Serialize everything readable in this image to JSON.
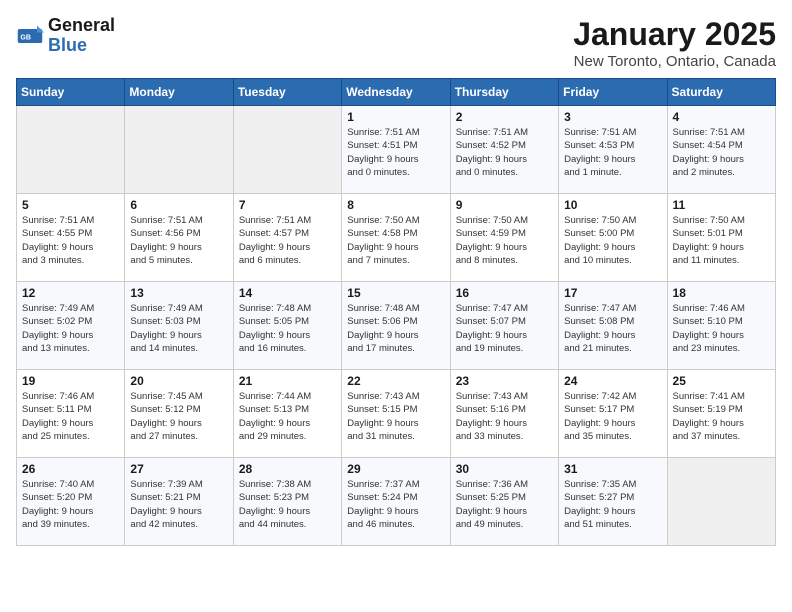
{
  "logo": {
    "line1": "General",
    "line2": "Blue"
  },
  "title": "January 2025",
  "subtitle": "New Toronto, Ontario, Canada",
  "days_header": [
    "Sunday",
    "Monday",
    "Tuesday",
    "Wednesday",
    "Thursday",
    "Friday",
    "Saturday"
  ],
  "weeks": [
    [
      {
        "num": "",
        "detail": ""
      },
      {
        "num": "",
        "detail": ""
      },
      {
        "num": "",
        "detail": ""
      },
      {
        "num": "1",
        "detail": "Sunrise: 7:51 AM\nSunset: 4:51 PM\nDaylight: 9 hours\nand 0 minutes."
      },
      {
        "num": "2",
        "detail": "Sunrise: 7:51 AM\nSunset: 4:52 PM\nDaylight: 9 hours\nand 0 minutes."
      },
      {
        "num": "3",
        "detail": "Sunrise: 7:51 AM\nSunset: 4:53 PM\nDaylight: 9 hours\nand 1 minute."
      },
      {
        "num": "4",
        "detail": "Sunrise: 7:51 AM\nSunset: 4:54 PM\nDaylight: 9 hours\nand 2 minutes."
      }
    ],
    [
      {
        "num": "5",
        "detail": "Sunrise: 7:51 AM\nSunset: 4:55 PM\nDaylight: 9 hours\nand 3 minutes."
      },
      {
        "num": "6",
        "detail": "Sunrise: 7:51 AM\nSunset: 4:56 PM\nDaylight: 9 hours\nand 5 minutes."
      },
      {
        "num": "7",
        "detail": "Sunrise: 7:51 AM\nSunset: 4:57 PM\nDaylight: 9 hours\nand 6 minutes."
      },
      {
        "num": "8",
        "detail": "Sunrise: 7:50 AM\nSunset: 4:58 PM\nDaylight: 9 hours\nand 7 minutes."
      },
      {
        "num": "9",
        "detail": "Sunrise: 7:50 AM\nSunset: 4:59 PM\nDaylight: 9 hours\nand 8 minutes."
      },
      {
        "num": "10",
        "detail": "Sunrise: 7:50 AM\nSunset: 5:00 PM\nDaylight: 9 hours\nand 10 minutes."
      },
      {
        "num": "11",
        "detail": "Sunrise: 7:50 AM\nSunset: 5:01 PM\nDaylight: 9 hours\nand 11 minutes."
      }
    ],
    [
      {
        "num": "12",
        "detail": "Sunrise: 7:49 AM\nSunset: 5:02 PM\nDaylight: 9 hours\nand 13 minutes."
      },
      {
        "num": "13",
        "detail": "Sunrise: 7:49 AM\nSunset: 5:03 PM\nDaylight: 9 hours\nand 14 minutes."
      },
      {
        "num": "14",
        "detail": "Sunrise: 7:48 AM\nSunset: 5:05 PM\nDaylight: 9 hours\nand 16 minutes."
      },
      {
        "num": "15",
        "detail": "Sunrise: 7:48 AM\nSunset: 5:06 PM\nDaylight: 9 hours\nand 17 minutes."
      },
      {
        "num": "16",
        "detail": "Sunrise: 7:47 AM\nSunset: 5:07 PM\nDaylight: 9 hours\nand 19 minutes."
      },
      {
        "num": "17",
        "detail": "Sunrise: 7:47 AM\nSunset: 5:08 PM\nDaylight: 9 hours\nand 21 minutes."
      },
      {
        "num": "18",
        "detail": "Sunrise: 7:46 AM\nSunset: 5:10 PM\nDaylight: 9 hours\nand 23 minutes."
      }
    ],
    [
      {
        "num": "19",
        "detail": "Sunrise: 7:46 AM\nSunset: 5:11 PM\nDaylight: 9 hours\nand 25 minutes."
      },
      {
        "num": "20",
        "detail": "Sunrise: 7:45 AM\nSunset: 5:12 PM\nDaylight: 9 hours\nand 27 minutes."
      },
      {
        "num": "21",
        "detail": "Sunrise: 7:44 AM\nSunset: 5:13 PM\nDaylight: 9 hours\nand 29 minutes."
      },
      {
        "num": "22",
        "detail": "Sunrise: 7:43 AM\nSunset: 5:15 PM\nDaylight: 9 hours\nand 31 minutes."
      },
      {
        "num": "23",
        "detail": "Sunrise: 7:43 AM\nSunset: 5:16 PM\nDaylight: 9 hours\nand 33 minutes."
      },
      {
        "num": "24",
        "detail": "Sunrise: 7:42 AM\nSunset: 5:17 PM\nDaylight: 9 hours\nand 35 minutes."
      },
      {
        "num": "25",
        "detail": "Sunrise: 7:41 AM\nSunset: 5:19 PM\nDaylight: 9 hours\nand 37 minutes."
      }
    ],
    [
      {
        "num": "26",
        "detail": "Sunrise: 7:40 AM\nSunset: 5:20 PM\nDaylight: 9 hours\nand 39 minutes."
      },
      {
        "num": "27",
        "detail": "Sunrise: 7:39 AM\nSunset: 5:21 PM\nDaylight: 9 hours\nand 42 minutes."
      },
      {
        "num": "28",
        "detail": "Sunrise: 7:38 AM\nSunset: 5:23 PM\nDaylight: 9 hours\nand 44 minutes."
      },
      {
        "num": "29",
        "detail": "Sunrise: 7:37 AM\nSunset: 5:24 PM\nDaylight: 9 hours\nand 46 minutes."
      },
      {
        "num": "30",
        "detail": "Sunrise: 7:36 AM\nSunset: 5:25 PM\nDaylight: 9 hours\nand 49 minutes."
      },
      {
        "num": "31",
        "detail": "Sunrise: 7:35 AM\nSunset: 5:27 PM\nDaylight: 9 hours\nand 51 minutes."
      },
      {
        "num": "",
        "detail": ""
      }
    ]
  ]
}
